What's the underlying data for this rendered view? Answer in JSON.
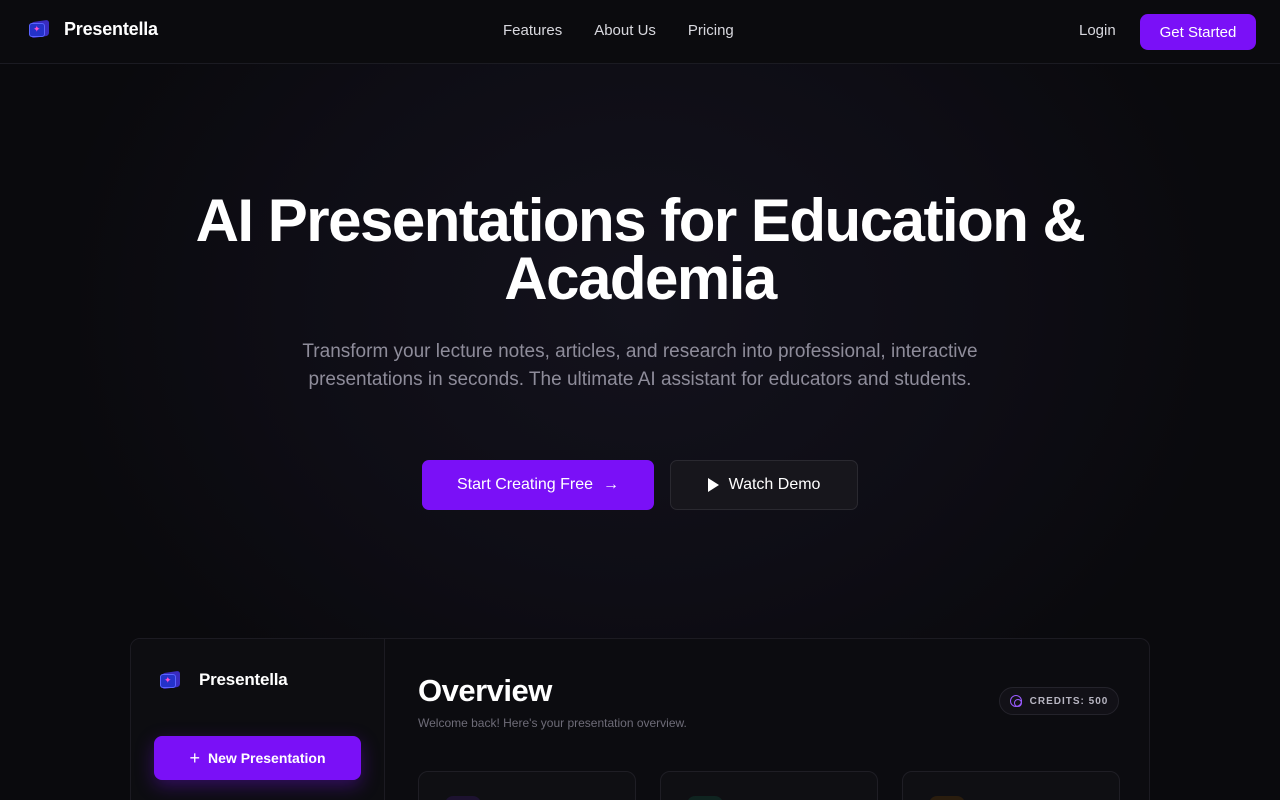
{
  "nav": {
    "brand": "Presentella",
    "links": [
      "Features",
      "About Us",
      "Pricing"
    ],
    "login": "Login",
    "get_started": "Get Started"
  },
  "hero": {
    "title_line1": "AI Presentations for Education &",
    "title_line2": "Academia",
    "subtitle": "Transform your lecture notes, articles, and research into professional, interactive presentations in seconds. The ultimate AI assistant for educators and students.",
    "primary_cta": "Start Creating Free",
    "secondary_cta": "Watch Demo"
  },
  "dashboard": {
    "brand": "Presentella",
    "new_presentation": "New Presentation",
    "title": "Overview",
    "subtitle": "Welcome back! Here's your presentation overview.",
    "credits": "CREDITS: 500"
  },
  "colors": {
    "accent": "#7a10f7",
    "background": "#0a0a0d",
    "muted_text": "#8e8c9a"
  }
}
